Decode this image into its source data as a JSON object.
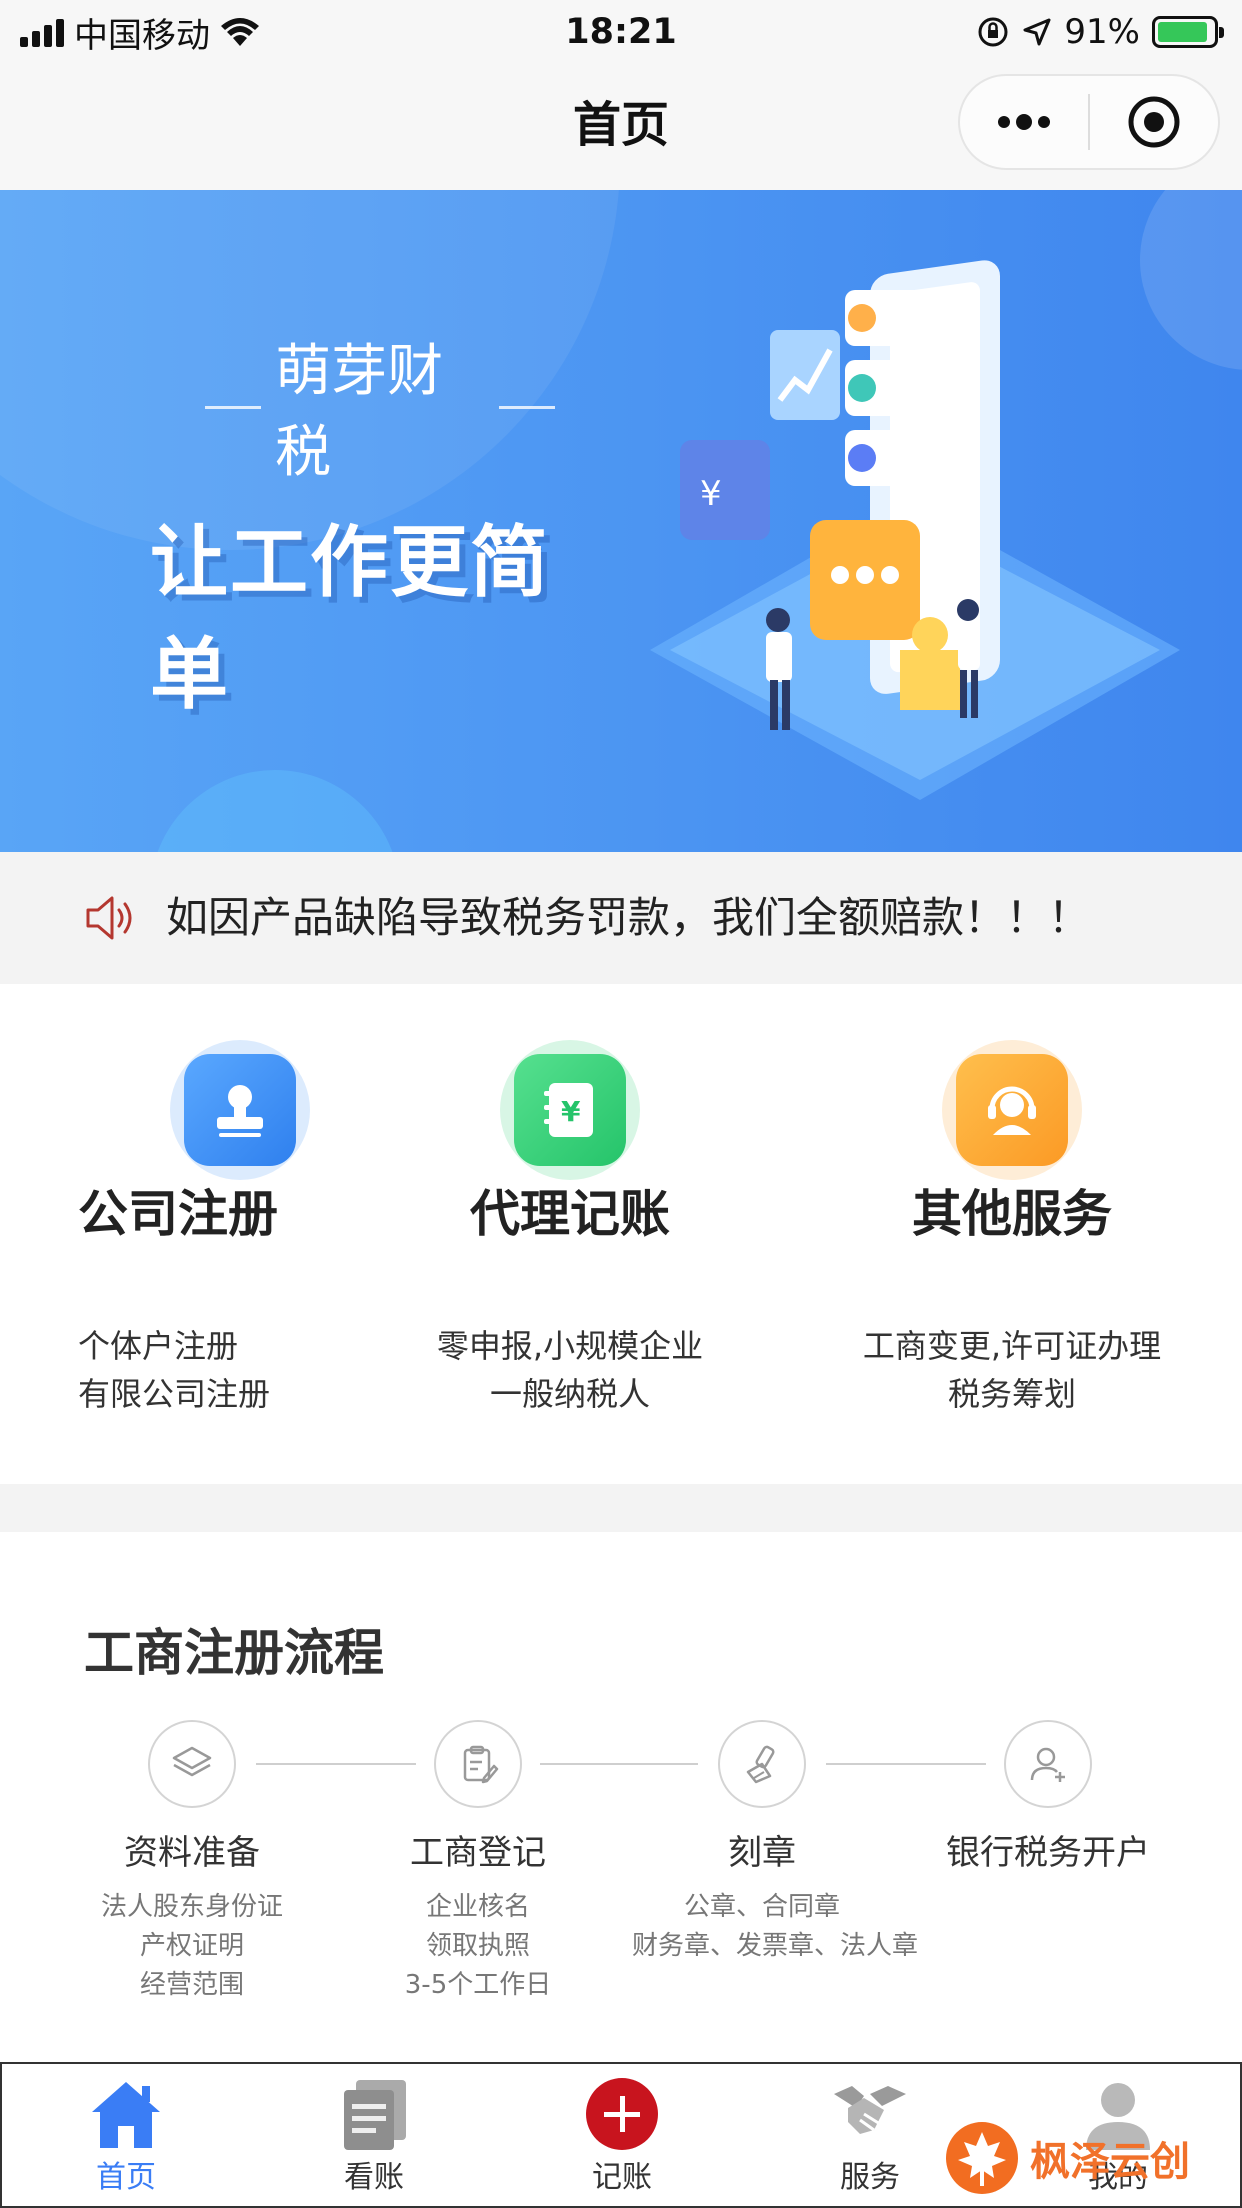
{
  "status_bar": {
    "carrier": "中国移动",
    "time": "18:21",
    "battery_percent": "91%",
    "battery_level": 0.91,
    "icons": [
      "signal-icon",
      "wifi-icon",
      "orientation-lock-icon",
      "location-icon",
      "battery-charging-icon"
    ]
  },
  "nav": {
    "title": "首页",
    "icons": [
      "more-dots-icon",
      "close-target-icon"
    ]
  },
  "banner": {
    "brand": "萌芽财税",
    "slogan": "让工作更简单"
  },
  "notice": {
    "icon": "speaker-icon",
    "text": "如因产品缺陷导致税务罚款，我们全额赔款！！！"
  },
  "services": [
    {
      "title": "公司注册",
      "icon": "stamp-icon",
      "color": "#3d8ff3",
      "desc_line1": "个体户注册",
      "desc_line2": "有限公司注册"
    },
    {
      "title": "代理记账",
      "icon": "ledger-yuan-icon",
      "color": "#3dd47c",
      "desc_line1": "零申报,小规模企业",
      "desc_line2": "一般纳税人"
    },
    {
      "title": "其他服务",
      "icon": "headset-support-icon",
      "color": "#fba535",
      "desc_line1": "工商变更,许可证办理",
      "desc_line2": "税务筹划"
    }
  ],
  "process": {
    "title": "工商注册流程",
    "steps": [
      {
        "name": "资料准备",
        "icon": "layers-icon",
        "lines": [
          "法人股东身份证",
          "产权证明",
          "经营范围"
        ]
      },
      {
        "name": "工商登记",
        "icon": "clipboard-edit-icon",
        "lines": [
          "企业核名",
          "领取执照",
          "3-5个工作日"
        ]
      },
      {
        "name": "刻章",
        "icon": "stamp-outline-icon",
        "lines": [
          "公章、合同章",
          "财务章、发票章、法人章"
        ]
      },
      {
        "name": "银行税务开户",
        "icon": "user-add-icon",
        "lines": []
      }
    ]
  },
  "tab_bar": {
    "active_color": "#3a7df5",
    "tabs": [
      {
        "label": "首页",
        "icon": "home-icon",
        "active": true
      },
      {
        "label": "看账",
        "icon": "documents-icon",
        "active": false
      },
      {
        "label": "记账",
        "icon": "add-circle-icon",
        "active": false
      },
      {
        "label": "服务",
        "icon": "handshake-icon",
        "active": false
      },
      {
        "label": "我的",
        "icon": "user-icon",
        "active": false
      }
    ]
  },
  "watermark": {
    "text": "枫泽云创",
    "icon": "maple-leaf-logo-icon"
  }
}
